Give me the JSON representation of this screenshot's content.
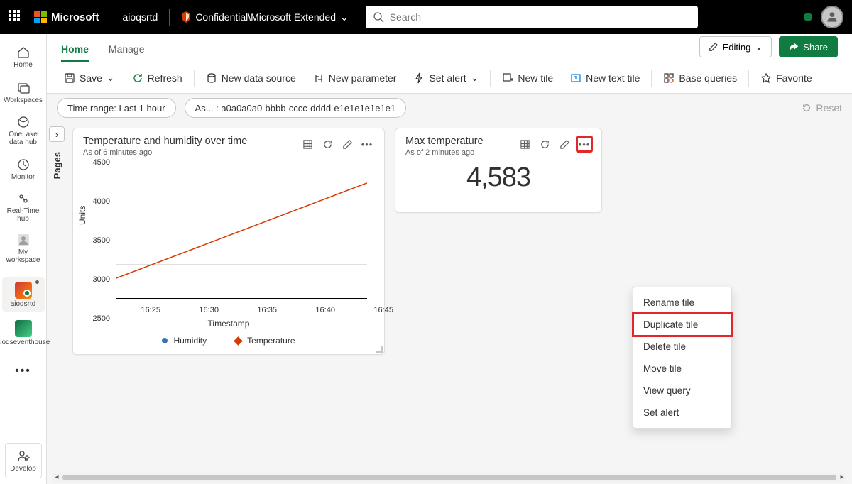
{
  "topbar": {
    "brand": "Microsoft",
    "workspace_name": "aioqsrtd",
    "sensitivity": "Confidential\\Microsoft Extended",
    "search_placeholder": "Search"
  },
  "leftrail": {
    "items": [
      {
        "label": "Home"
      },
      {
        "label": "Workspaces"
      },
      {
        "label": "OneLake data hub"
      },
      {
        "label": "Monitor"
      },
      {
        "label": "Real-Time hub"
      },
      {
        "label": "My workspace"
      },
      {
        "label": "aioqsrtd"
      },
      {
        "label": "aioqseventhouse"
      }
    ],
    "develop": "Develop"
  },
  "tabs": {
    "home": "Home",
    "manage": "Manage",
    "editing": "Editing",
    "share": "Share"
  },
  "toolbar": {
    "save": "Save",
    "refresh": "Refresh",
    "new_data_source": "New data source",
    "new_parameter": "New parameter",
    "set_alert": "Set alert",
    "new_tile": "New tile",
    "new_text_tile": "New text tile",
    "base_queries": "Base queries",
    "favorite": "Favorite"
  },
  "filters": {
    "time_range": "Time range: Last 1 hour",
    "asset": "As... : a0a0a0a0-bbbb-cccc-dddd-e1e1e1e1e1e1",
    "reset": "Reset"
  },
  "pages": {
    "label": "Pages"
  },
  "tiles": {
    "temp_humidity": {
      "title": "Temperature and humidity over time",
      "subtitle": "As of 6 minutes ago",
      "legend_humidity": "Humidity",
      "legend_temperature": "Temperature",
      "xlabel": "Timestamp",
      "ylabel": "Units"
    },
    "max_temp": {
      "title": "Max temperature",
      "subtitle": "As of 2 minutes ago",
      "value": "4,583"
    }
  },
  "context_menu": {
    "rename": "Rename tile",
    "duplicate": "Duplicate tile",
    "delete": "Delete tile",
    "move": "Move tile",
    "view_query": "View query",
    "set_alert": "Set alert"
  },
  "chart_data": {
    "type": "line",
    "title": "Temperature and humidity over time",
    "xlabel": "Timestamp",
    "ylabel": "Units",
    "ylim": [
      2500,
      4500
    ],
    "x_ticks": [
      "16:25",
      "16:30",
      "16:35",
      "16:40",
      "16:45"
    ],
    "y_ticks": [
      2500,
      3000,
      3500,
      4000,
      4500
    ],
    "series": [
      {
        "name": "Temperature",
        "color": "#d83b01",
        "x": [
          "16:23",
          "16:47"
        ],
        "values": [
          2800,
          4200
        ]
      },
      {
        "name": "Humidity",
        "color": "#3a72b5",
        "x": [],
        "values": []
      }
    ]
  }
}
